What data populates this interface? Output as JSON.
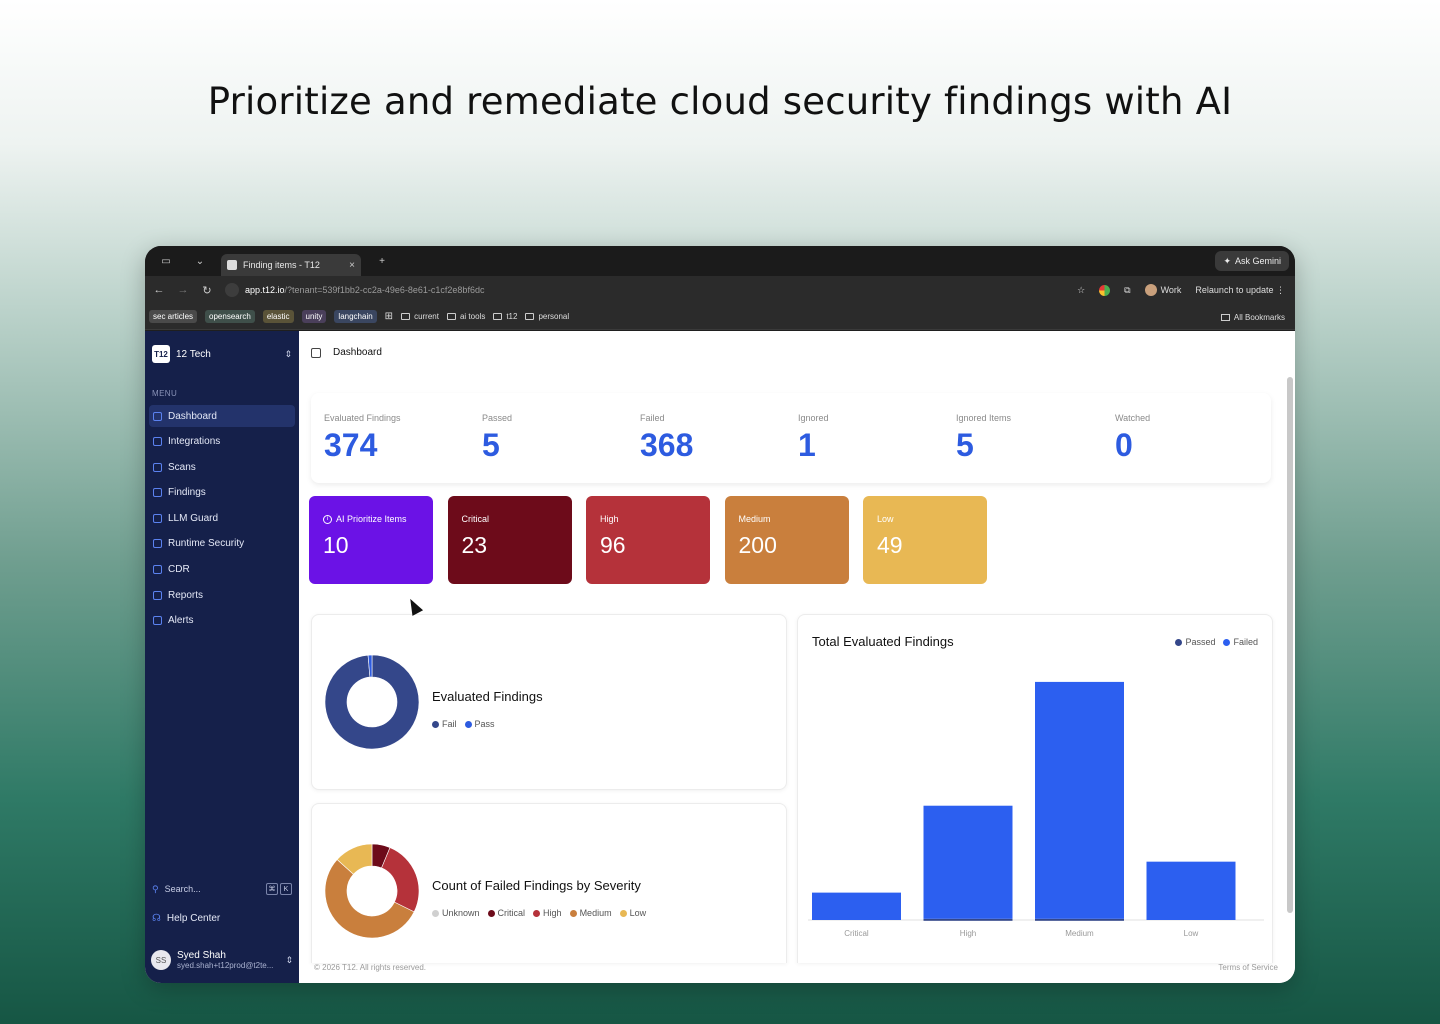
{
  "headline": "Prioritize and remediate cloud security findings with AI",
  "browser": {
    "tab_title": "Finding items - T12",
    "new_tab": "+",
    "ask_gemini": "Ask Gemini",
    "url_host": "app.t12.io",
    "url_rest": "/?tenant=539f1bb2-cc2a-49e6-8e61-c1cf2e8bf6dc",
    "profile": "Work",
    "relaunch": "Relaunch to update",
    "bookmarks_chips": [
      {
        "label": "sec articles",
        "color": "#4a4a4a"
      },
      {
        "label": "opensearch",
        "color": "#3f4f4a"
      },
      {
        "label": "elastic",
        "color": "#5a5338"
      },
      {
        "label": "unity",
        "color": "#4a3f5a"
      },
      {
        "label": "langchain",
        "color": "#3a4660"
      }
    ],
    "bookmark_folders": [
      "current",
      "ai tools",
      "t12",
      "personal"
    ],
    "all_bookmarks": "All Bookmarks"
  },
  "sidebar": {
    "org_logo": "T12",
    "org_name": "12 Tech",
    "menu_label": "MENU",
    "items": [
      {
        "label": "Dashboard",
        "icon": "dashboard-icon"
      },
      {
        "label": "Integrations",
        "icon": "integrations-icon"
      },
      {
        "label": "Scans",
        "icon": "scans-icon"
      },
      {
        "label": "Findings",
        "icon": "findings-icon"
      },
      {
        "label": "LLM Guard",
        "icon": "llm-guard-icon"
      },
      {
        "label": "Runtime Security",
        "icon": "runtime-security-icon"
      },
      {
        "label": "CDR",
        "icon": "cdr-icon"
      },
      {
        "label": "Reports",
        "icon": "reports-icon"
      },
      {
        "label": "Alerts",
        "icon": "alerts-icon"
      }
    ],
    "search_label": "Search...",
    "search_keys": [
      "⌘",
      "K"
    ],
    "help": "Help Center",
    "user_initials": "SS",
    "user_name": "Syed Shah",
    "user_email": "syed.shah+t12prod@t2te..."
  },
  "main": {
    "breadcrumb": "Dashboard",
    "stats": [
      {
        "label": "Evaluated Findings",
        "value": "374"
      },
      {
        "label": "Passed",
        "value": "5"
      },
      {
        "label": "Failed",
        "value": "368"
      },
      {
        "label": "Ignored",
        "value": "1"
      },
      {
        "label": "Ignored Items",
        "value": "5"
      },
      {
        "label": "Watched",
        "value": "0"
      }
    ],
    "severity_cards": [
      {
        "label": "AI Prioritize Items",
        "value": "10",
        "color": "#6b12e6"
      },
      {
        "label": "Critical",
        "value": "23",
        "color": "#6d0b1a"
      },
      {
        "label": "High",
        "value": "96",
        "color": "#b5323a"
      },
      {
        "label": "Medium",
        "value": "200",
        "color": "#c97f3d"
      },
      {
        "label": "Low",
        "value": "49",
        "color": "#e8b854"
      }
    ],
    "evaluated_card": {
      "title": "Evaluated Findings",
      "legend": [
        "Fail",
        "Pass"
      ]
    },
    "severity_donut_card": {
      "title": "Count of Failed Findings by Severity",
      "legend": [
        "Unknown",
        "Critical",
        "High",
        "Medium",
        "Low"
      ]
    },
    "bar_card": {
      "title": "Total Evaluated Findings",
      "legend": [
        "Passed",
        "Failed"
      ]
    },
    "footer_left": "© 2026 T12. All rights reserved.",
    "footer_right": "Terms of Service"
  },
  "chart_data": [
    {
      "type": "pie",
      "title": "Evaluated Findings",
      "categories": [
        "Fail",
        "Pass"
      ],
      "values": [
        368,
        5
      ],
      "colors": [
        "#34478a",
        "#2d5be0"
      ]
    },
    {
      "type": "pie",
      "title": "Count of Failed Findings by Severity",
      "categories": [
        "Unknown",
        "Critical",
        "High",
        "Medium",
        "Low"
      ],
      "values": [
        0,
        23,
        96,
        200,
        49
      ],
      "colors": [
        "#d0d0d0",
        "#6d0b1a",
        "#b5323a",
        "#c97f3d",
        "#e8b854"
      ]
    },
    {
      "type": "bar",
      "title": "Total Evaluated Findings",
      "categories": [
        "Critical",
        "High",
        "Medium",
        "Low"
      ],
      "series": [
        {
          "name": "Passed",
          "values": [
            0,
            1,
            1,
            0
          ],
          "color": "#34478a"
        },
        {
          "name": "Failed",
          "values": [
            23,
            95,
            199,
            49
          ],
          "color": "#2c5ff0"
        }
      ],
      "ylim": [
        0,
        210
      ],
      "grid": false,
      "legend": "top-right"
    }
  ]
}
